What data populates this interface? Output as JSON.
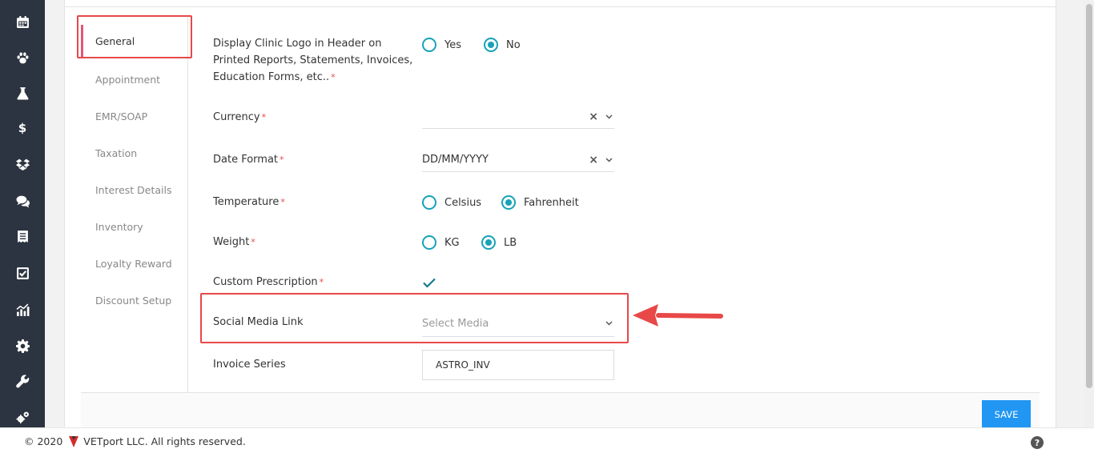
{
  "nav": {
    "items": [
      {
        "label": "General",
        "active": true
      },
      {
        "label": "Appointment"
      },
      {
        "label": "EMR/SOAP"
      },
      {
        "label": "Taxation"
      },
      {
        "label": "Interest Details"
      },
      {
        "label": "Inventory"
      },
      {
        "label": "Loyalty Reward"
      },
      {
        "label": "Discount Setup"
      }
    ]
  },
  "rail": {
    "icons": [
      "calendar-icon",
      "paw-icon",
      "flask-icon",
      "dollar-icon",
      "dropbox-icon",
      "chat-icon",
      "receipt-icon",
      "checkbox-icon",
      "chart-icon",
      "gear-icon",
      "wrench-icon",
      "gears-icon"
    ],
    "dollar_glyph": "$"
  },
  "form": {
    "clinic_logo": {
      "label": "Display Clinic Logo in Header on Printed Reports, Statements, Invoices, Education Forms, etc..",
      "required": "*",
      "options": [
        {
          "label": "Yes",
          "checked": false
        },
        {
          "label": "No",
          "checked": true
        }
      ]
    },
    "currency": {
      "label": "Currency",
      "required": "*",
      "value": "",
      "clear": "×"
    },
    "date_format": {
      "label": "Date Format",
      "required": "*",
      "value": "DD/MM/YYYY",
      "clear": "×"
    },
    "temperature": {
      "label": "Temperature",
      "required": "*",
      "options": [
        {
          "label": "Celsius",
          "checked": false
        },
        {
          "label": "Fahrenheit",
          "checked": true
        }
      ]
    },
    "weight": {
      "label": "Weight",
      "required": "*",
      "options": [
        {
          "label": "KG",
          "checked": false
        },
        {
          "label": "LB",
          "checked": true
        }
      ]
    },
    "custom_prescription": {
      "label": "Custom Prescription",
      "required": "*",
      "checked": true
    },
    "social_media": {
      "label": "Social Media Link",
      "placeholder": "Select Media"
    },
    "invoice_series": {
      "label": "Invoice Series",
      "value": "ASTRO_INV"
    }
  },
  "actions": {
    "save_label": "SAVE"
  },
  "footer": {
    "copyright_prefix": "© 2020",
    "copyright_suffix": "VETport LLC. All rights reserved.",
    "help": "?"
  },
  "colors": {
    "accent": "#17a2b8",
    "save_button": "#2196f3",
    "annotation_red": "#e84848",
    "rail_bg": "#2b3440",
    "nav_active_bar": "#e0577a"
  }
}
